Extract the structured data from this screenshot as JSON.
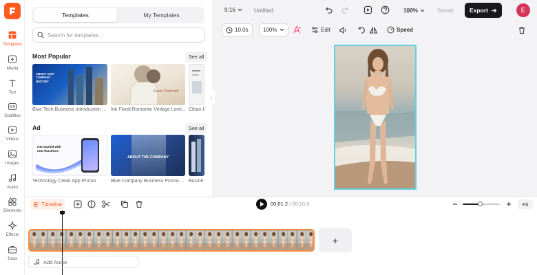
{
  "rail": {
    "items": [
      {
        "label": "Templates"
      },
      {
        "label": "Media"
      },
      {
        "label": "Text"
      },
      {
        "label": "Subtitles"
      },
      {
        "label": "Videos"
      },
      {
        "label": "Images"
      },
      {
        "label": "Audio"
      },
      {
        "label": "Elements"
      },
      {
        "label": "Effects"
      },
      {
        "label": "Tools"
      }
    ]
  },
  "panel": {
    "tabs": [
      "Templates",
      "My Templates"
    ],
    "search_placeholder": "Search for templates...",
    "sections": [
      {
        "title": "Most Popular",
        "see_all": "See all",
        "cards": [
          {
            "caption": "Blue Tech Business Introduction ...",
            "thumb_text": "ABOUT OUR COMPANY HISTORY"
          },
          {
            "caption": "Ink Floral Romantic Vintage Love...",
            "thumb_text": "Love Forever"
          },
          {
            "caption": "Clean B"
          }
        ]
      },
      {
        "title": "Ad",
        "see_all": "See all",
        "cards": [
          {
            "caption": "Technology Clean App Promo",
            "thumb_text": "Get started with new functions"
          },
          {
            "caption": "Blue Company Business Promo ...",
            "thumb_text": "ABOUT THE COMPANY"
          },
          {
            "caption": "Busine"
          }
        ]
      }
    ]
  },
  "topbar": {
    "aspect": "9:16",
    "title": "Untitled",
    "zoom": "100%",
    "saved": "Saved",
    "export": "Export",
    "avatar": "E"
  },
  "toolbar": {
    "duration": "10.0s",
    "scale": "100%",
    "edit": "Edit",
    "speed": "Speed"
  },
  "timeline": {
    "tab": "Timeline",
    "current_time": "00:01.2",
    "separator": " / ",
    "total_time": "00:10.0",
    "fit": "Fit",
    "add_audio": "Add Audio",
    "add_clip": "+",
    "zoom_level": 0.48
  },
  "colors": {
    "accent": "#ff5a1f",
    "selection": "#5fd0e2",
    "clip_border": "#ff8a3d"
  }
}
